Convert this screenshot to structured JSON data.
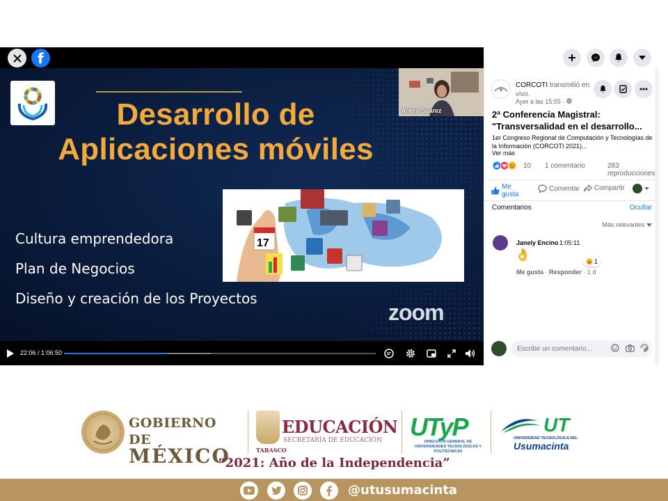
{
  "video": {
    "webcam_name": "Anery Suárez",
    "time_label": "22:06 / 1:06:50",
    "progress_fraction": 0.33,
    "buffer_fraction": 0.47
  },
  "slide": {
    "title_line1": "Desarrollo de",
    "title_line2": "Aplicaciones móviles",
    "bullets": [
      "Cultura emprendedora",
      "Plan de Negocios",
      "Diseño y creación de los Proyectos"
    ],
    "calendar_number": "17",
    "watermark": "zoom"
  },
  "post": {
    "page_name": "CORCOTI",
    "action_text": "transmitió en vivo.",
    "time": "Ayer a las 15:55 ·",
    "title": "2ª Conferencia Magistral: \"Transversalidad en el desarrollo...",
    "description": "1er Congreso Regional de Computación y Tecnologías de la Información (CORCOTI 2021)...",
    "see_more": "Ver más",
    "reaction_count": "10",
    "comment_count": "1 comentario",
    "views": "283 reproducciones",
    "like_label": "Me gusta",
    "comment_label": "Comentar",
    "share_label": "Compartir"
  },
  "comments": {
    "title": "Comentarios",
    "hide": "Ocultar",
    "sort": "Más relevantes",
    "items": [
      {
        "name": "Janely Encino",
        "time": "1:05:11",
        "emoji": "👌",
        "reaction_count": "1",
        "like": "Me gusta",
        "reply": "Responder",
        "age": "1 d"
      }
    ],
    "input_placeholder": "Escribe un comentario..."
  },
  "footer": {
    "gob_line1": "GOBIERNO DE",
    "gob_line2": "MÉXICO",
    "state": "TABASCO",
    "edu_title": "EDUCACIÓN",
    "edu_sub": "SECRETARÍA DE EDUCACIÓN",
    "utp_logo": "UTyP",
    "utp_sub": "DIRECCIÓN GENERAL DE UNIVERSIDADES TECNOLÓGICAS Y POLITÉCNICAS",
    "ut_sub": "UNIVERSIDAD TECNOLÓGICA DEL",
    "ut_name": "Usumacinta",
    "motto": "“2021: Año de la Independencia”",
    "handle": "@utusumacinta"
  },
  "colors": {
    "facebook_blue": "#1877f2",
    "slide_title": "#f4a93c",
    "band": "#b8955f",
    "edu_red": "#8a2a3e",
    "utp_green": "#1aa64a"
  }
}
